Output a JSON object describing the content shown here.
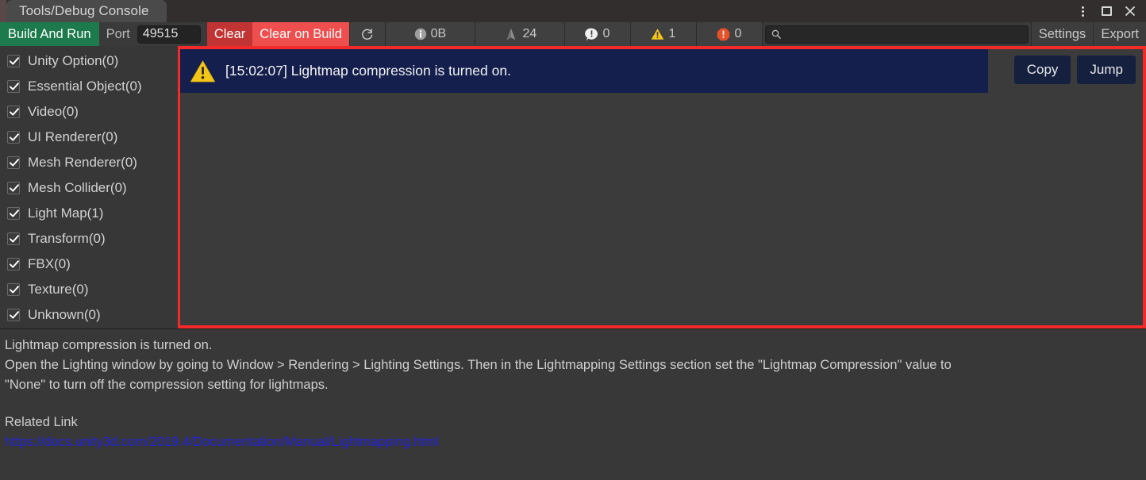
{
  "window": {
    "tab_title": "Tools/Debug Console",
    "controls": [
      {
        "name": "menu-dots",
        "icon": "more-vertical-icon"
      },
      {
        "name": "maximize",
        "icon": "maximize-icon"
      },
      {
        "name": "close",
        "icon": "close-icon"
      }
    ],
    "close_glyph": "✕"
  },
  "toolbar": {
    "build_and_run_label": "Build And Run",
    "port_label": "Port",
    "port_value": "49515",
    "clear_label": "Clear",
    "clear_on_build_label": "Clear on Build",
    "refresh_icon": "refresh-icon",
    "size_icon": "info-icon",
    "size_value": "0B",
    "unity_icon": "unity-logo-icon",
    "unity_count": "24",
    "log_icon": "message-icon",
    "log_count": "0",
    "warning_icon": "warning-triangle-icon",
    "warning_count": "1",
    "error_icon": "error-octagon-icon",
    "error_count": "0",
    "search_icon": "search-icon",
    "search_value": "",
    "search_placeholder": "",
    "settings_label": "Settings",
    "export_label": "Export"
  },
  "sidebar": {
    "items": [
      {
        "label": "Unity Option(0)",
        "checked": true,
        "name": "unity-option"
      },
      {
        "label": "Essential Object(0)",
        "checked": true,
        "name": "essential-object"
      },
      {
        "label": "Video(0)",
        "checked": true,
        "name": "video"
      },
      {
        "label": "UI Renderer(0)",
        "checked": true,
        "name": "ui-renderer"
      },
      {
        "label": "Mesh Renderer(0)",
        "checked": true,
        "name": "mesh-renderer"
      },
      {
        "label": "Mesh Collider(0)",
        "checked": true,
        "name": "mesh-collider"
      },
      {
        "label": "Light Map(1)",
        "checked": true,
        "name": "light-map"
      },
      {
        "label": "Transform(0)",
        "checked": true,
        "name": "transform"
      },
      {
        "label": "FBX(0)",
        "checked": true,
        "name": "fbx"
      },
      {
        "label": "Texture(0)",
        "checked": true,
        "name": "texture"
      },
      {
        "label": "Unknown(0)",
        "checked": true,
        "name": "unknown"
      }
    ]
  },
  "log": {
    "selected_entry": {
      "severity_icon": "warning-triangle-icon",
      "timestamp": "[15:02:07]",
      "message": "Lightmap compression is turned on.",
      "full_text": "[15:02:07] Lightmap compression is turned on."
    },
    "copy_label": "Copy",
    "jump_label": "Jump"
  },
  "detail": {
    "line1": "Lightmap compression is turned on.",
    "line2": "Open the Lighting window by going to Window > Rendering > Lighting Settings. Then in the Lightmapping Settings section set the \"Lightmap Compression\" value to",
    "line3": "\"None\" to turn off the compression setting for lightmaps.",
    "related_link_label": "Related Link",
    "link_url": "https://docs.unity3d.com/2019.4/Documentation/Manual/Lightmapping.html"
  },
  "colors": {
    "accent_red": "#f22a2a",
    "build_green": "#1d7a4c",
    "clear_red": "#c23434",
    "clear_on_build_red": "#ef4e4e",
    "selection_navy": "#141f4d",
    "warning_yellow": "#f5c518",
    "error_orange": "#e8502a",
    "link_blue": "#2222dd",
    "panel_bg": "#373737"
  }
}
